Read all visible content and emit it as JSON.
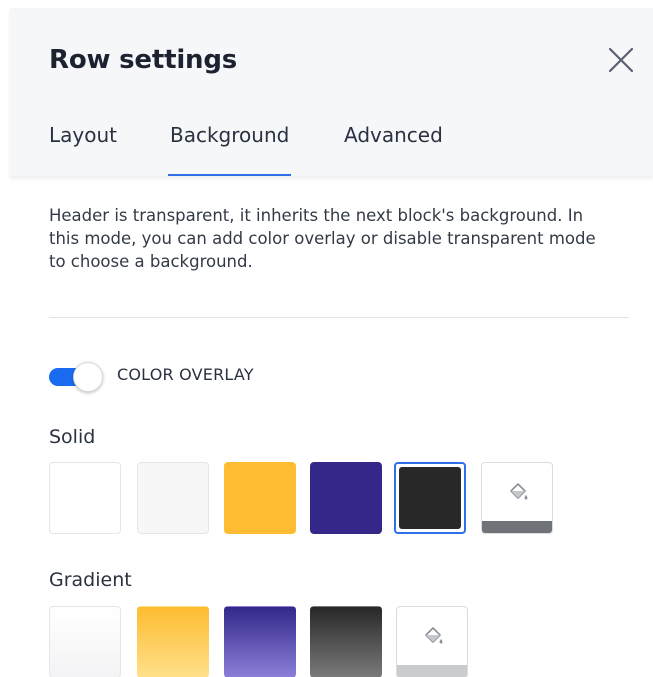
{
  "header": {
    "title": "Row settings",
    "tabs": [
      {
        "label": "Layout",
        "active": false
      },
      {
        "label": "Background",
        "active": true
      },
      {
        "label": "Advanced",
        "active": false
      }
    ]
  },
  "description": "Header is transparent, it inherits the next block's background. In this mode, you can add color overlay or disable transparent mode to choose a background.",
  "overlay": {
    "label": "COLOR OVERLAY",
    "enabled": true
  },
  "solid": {
    "label": "Solid",
    "swatches": [
      "#ffffff",
      "#f7f7f8",
      "#fdbc31",
      "#33288a",
      "#282828"
    ],
    "selected": "#282828"
  },
  "gradient": {
    "label": "Gradient",
    "swatches": [
      {
        "from": "#ffffff",
        "to": "#f3f3f5"
      },
      {
        "from": "#fdbc31",
        "to": "#ffe08a"
      },
      {
        "from": "#33288a",
        "to": "#8a7fd8"
      },
      {
        "from": "#282828",
        "to": "#7a7a7a"
      }
    ]
  },
  "colors": {
    "accent": "#2f6fe8",
    "toggle_on": "#1a6bf0"
  }
}
